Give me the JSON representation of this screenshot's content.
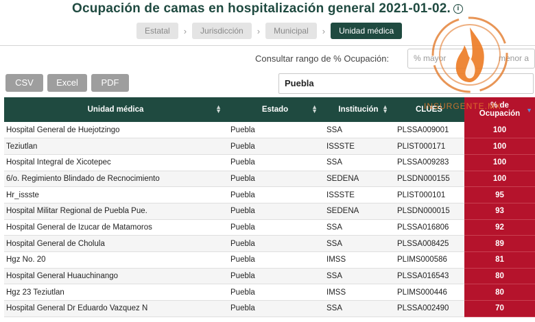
{
  "page": {
    "title": "Ocupación de camas en hospitalización general 2021-01-02.",
    "info_icon": "i"
  },
  "breadcrumbs": [
    "Estatal",
    "Jurisdicción",
    "Municipal",
    "Unidad médica"
  ],
  "filters": {
    "range_label": "Consultar rango de % Ocupación:",
    "range_placeholder_left": "% mayor",
    "range_placeholder_right": "menor a",
    "search_value": "Puebla"
  },
  "export": {
    "csv": "CSV",
    "excel": "Excel",
    "pdf": "PDF"
  },
  "table": {
    "headers": {
      "unit": "Unidad médica",
      "state": "Estado",
      "institution": "Institución",
      "clues": "CLUES",
      "pct_line1": "% de",
      "pct_line2": "Ocupación"
    },
    "rows": [
      {
        "unit": "Hospital General de Huejotzingo",
        "state": "Puebla",
        "inst": "SSA",
        "clues": "PLSSA009001",
        "pct": "100"
      },
      {
        "unit": "Teziutlan",
        "state": "Puebla",
        "inst": "ISSSTE",
        "clues": "PLIST000171",
        "pct": "100"
      },
      {
        "unit": "Hospital Integral de Xicotepec",
        "state": "Puebla",
        "inst": "SSA",
        "clues": "PLSSA009283",
        "pct": "100"
      },
      {
        "unit": "6/o. Regimiento Blindado de Recnocimiento",
        "state": "Puebla",
        "inst": "SEDENA",
        "clues": "PLSDN000155",
        "pct": "100"
      },
      {
        "unit": "Hr_issste",
        "state": "Puebla",
        "inst": "ISSSTE",
        "clues": "PLIST000101",
        "pct": "95"
      },
      {
        "unit": "Hospital Militar Regional de Puebla Pue.",
        "state": "Puebla",
        "inst": "SEDENA",
        "clues": "PLSDN000015",
        "pct": "93"
      },
      {
        "unit": "Hospital General de Izucar de Matamoros",
        "state": "Puebla",
        "inst": "SSA",
        "clues": "PLSSA016806",
        "pct": "92"
      },
      {
        "unit": "Hospital General de Cholula",
        "state": "Puebla",
        "inst": "SSA",
        "clues": "PLSSA008425",
        "pct": "89"
      },
      {
        "unit": "Hgz No. 20",
        "state": "Puebla",
        "inst": "IMSS",
        "clues": "PLIMS000586",
        "pct": "81"
      },
      {
        "unit": "Hospital General Huauchinango",
        "state": "Puebla",
        "inst": "SSA",
        "clues": "PLSSA016543",
        "pct": "80"
      },
      {
        "unit": "Hgz 23 Teziutlan",
        "state": "Puebla",
        "inst": "IMSS",
        "clues": "PLIMS000446",
        "pct": "80"
      },
      {
        "unit": "Hospital General Dr Eduardo Vazquez N",
        "state": "Puebla",
        "inst": "SSA",
        "clues": "PLSSA002490",
        "pct": "70"
      }
    ]
  },
  "watermark": {
    "text": "INSURGENTE.MX"
  },
  "colors": {
    "primary": "#1f4a40",
    "high_occupancy": "#b5132c",
    "button_gray": "#9e9e9e"
  }
}
